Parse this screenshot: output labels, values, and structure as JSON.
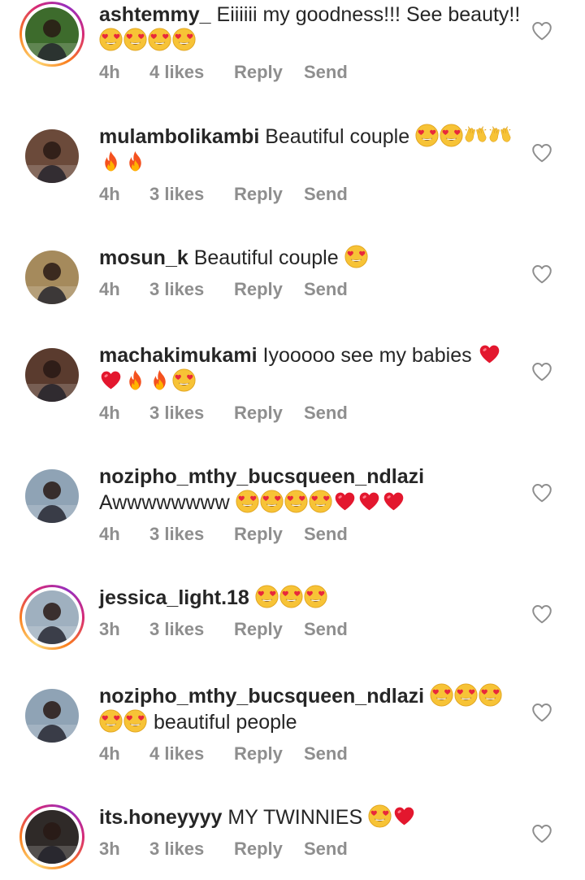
{
  "comments": [
    {
      "username": "ashtemmy_",
      "text": "Eiiiiii my goodness!!! See beauty!!",
      "emojis_after": [
        "heart-eyes",
        "heart-eyes",
        "heart-eyes",
        "heart-eyes"
      ],
      "time": "4h",
      "likes": "4 likes",
      "reply": "Reply",
      "send": "Send",
      "story_ring": true,
      "avatar_color": "#3d6b2c"
    },
    {
      "username": "mulambolikambi",
      "text": "Beautiful couple",
      "emojis_after": [
        "heart-eyes",
        "heart-eyes",
        "raising-hands",
        "raising-hands",
        "fire",
        "fire"
      ],
      "time": "4h",
      "likes": "3 likes",
      "reply": "Reply",
      "send": "Send",
      "story_ring": false,
      "avatar_color": "#6b4a3a"
    },
    {
      "username": "mosun_k",
      "text": "Beautiful couple",
      "emojis_after": [
        "heart-eyes"
      ],
      "time": "4h",
      "likes": "3 likes",
      "reply": "Reply",
      "send": "Send",
      "story_ring": false,
      "avatar_color": "#a58a5c"
    },
    {
      "username": "machakimukami",
      "text": "Iyooooo see my babies",
      "emojis_after": [
        "red-heart",
        "red-heart",
        "fire",
        "fire",
        "heart-eyes"
      ],
      "time": "4h",
      "likes": "3 likes",
      "reply": "Reply",
      "send": "Send",
      "story_ring": false,
      "avatar_color": "#5a3b2e"
    },
    {
      "username": "nozipho_mthy_bucsqueen_ndlazi",
      "text": "Awwwwwwww",
      "emojis_after": [
        "heart-eyes",
        "heart-eyes",
        "heart-eyes",
        "heart-eyes",
        "red-heart",
        "red-heart",
        "red-heart"
      ],
      "time": "4h",
      "likes": "3 likes",
      "reply": "Reply",
      "send": "Send",
      "story_ring": false,
      "avatar_color": "#8fa3b5"
    },
    {
      "username": "jessica_light.18",
      "text": "",
      "emojis_after": [
        "heart-eyes",
        "heart-eyes",
        "heart-eyes"
      ],
      "time": "3h",
      "likes": "3 likes",
      "reply": "Reply",
      "send": "Send",
      "story_ring": true,
      "avatar_color": "#9fb0bf"
    },
    {
      "username": "nozipho_mthy_bucsqueen_ndlazi",
      "text": "",
      "emojis_after": [
        "heart-eyes",
        "heart-eyes",
        "heart-eyes",
        "heart-eyes",
        "heart-eyes"
      ],
      "text_after": "beautiful people",
      "time": "4h",
      "likes": "4 likes",
      "reply": "Reply",
      "send": "Send",
      "story_ring": false,
      "avatar_color": "#8fa3b5"
    },
    {
      "username": "its.honeyyyy",
      "text": "MY TWINNIES",
      "emojis_after": [
        "heart-eyes",
        "red-heart"
      ],
      "time": "3h",
      "likes": "3 likes",
      "reply": "Reply",
      "send": "Send",
      "story_ring": true,
      "avatar_color": "#2f2a28"
    }
  ]
}
